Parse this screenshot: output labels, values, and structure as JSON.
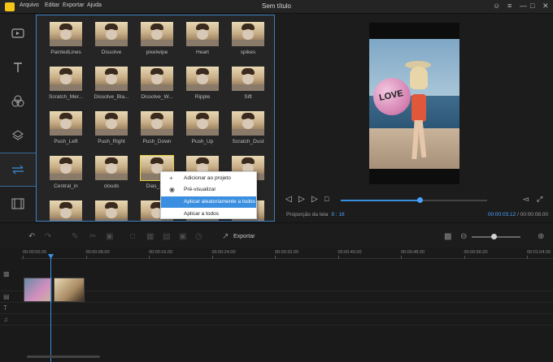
{
  "app": {
    "title": "Sem título",
    "menu": [
      "Arquivo",
      "Editar",
      "Exportar",
      "Ajuda"
    ],
    "window_icons": [
      "user-icon",
      "menu-icon",
      "minimize-icon",
      "maximize-icon",
      "close-icon"
    ]
  },
  "toolbar": {
    "items": [
      {
        "name": "media-tab",
        "icon": "media-icon"
      },
      {
        "name": "text-tab",
        "icon": "text-icon"
      },
      {
        "name": "filters-tab",
        "icon": "filters-icon"
      },
      {
        "name": "overlays-tab",
        "icon": "overlays-icon"
      },
      {
        "name": "transitions-tab",
        "icon": "transitions-icon",
        "active": true
      },
      {
        "name": "elements-tab",
        "icon": "film-icon"
      }
    ]
  },
  "transitions": [
    [
      "PaintedLines",
      "Dissolve",
      "pixelwipe",
      "Heart",
      "spikes"
    ],
    [
      "Scratch_Mer...",
      "Dissolve_Bla...",
      "Dissolve_W...",
      "Ripple",
      "Sift"
    ],
    [
      "Push_Left",
      "Push_Right",
      "Push_Down",
      "Push_Up",
      "Scratch_Dust"
    ],
    [
      "Central_in",
      "clouds",
      "Dias_D...",
      "",
      ""
    ],
    [
      "",
      "",
      "",
      "",
      ""
    ]
  ],
  "context_menu": {
    "items": [
      {
        "label": "Adicionar ao projeto",
        "icon": "plus-icon"
      },
      {
        "label": "Pré-visualizar",
        "icon": "eye-icon"
      },
      {
        "label": "Aplicar aleatoriamente a todos",
        "icon": "",
        "highlighted": true
      },
      {
        "label": "Aplicar a todos",
        "icon": ""
      }
    ]
  },
  "preview": {
    "ball_text": "LOVE",
    "ratio_label": "Proporção da tela",
    "ratio_value": "9 : 16",
    "current_time": "00:00:03.12",
    "total_time": "00:00:08.00",
    "progress": 0.54
  },
  "edit_toolbar": {
    "export_label": "Exportar",
    "zoom_level": 0.45
  },
  "timeline": {
    "ticks": [
      "00:00:00.00",
      "00:00:08.00",
      "00:00:16.00",
      "00:00:24.00",
      "00:00:32.00",
      "00:00:40.00",
      "00:00:48.00",
      "00:00:56.00",
      "00:01:04.00"
    ]
  },
  "colors": {
    "accent": "#3b8fe0",
    "selected_thumb": "#e8d23a",
    "panel_border": "#3b7fc0"
  }
}
